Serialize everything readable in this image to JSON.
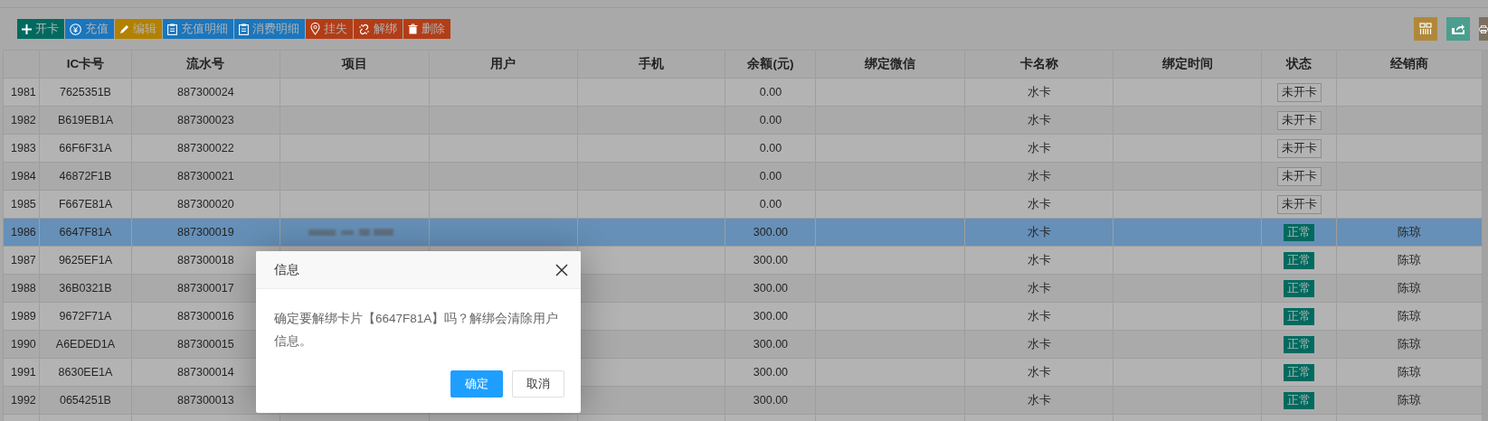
{
  "toolbar": {
    "buttons": [
      {
        "label": "开卡",
        "kind": "plus",
        "color": "#006a5f"
      },
      {
        "label": "充值",
        "kind": "yen",
        "color": "#1a76bd"
      },
      {
        "label": "编辑",
        "kind": "pencil",
        "color": "#b28100"
      },
      {
        "label": "充值明细",
        "kind": "clipboard",
        "color": "#1a76bd"
      },
      {
        "label": "消费明细",
        "kind": "clipboard",
        "color": "#1a76bd"
      },
      {
        "label": "挂失",
        "kind": "pin",
        "color": "#b23d17"
      },
      {
        "label": "解绑",
        "kind": "unlink",
        "color": "#b23d17"
      },
      {
        "label": "删除",
        "kind": "trash",
        "color": "#b23d17"
      }
    ],
    "tools": [
      {
        "kind": "grid",
        "color": "#b0883a"
      },
      {
        "kind": "export",
        "color": "#4a9f8f"
      },
      {
        "kind": "print",
        "color": "#7d7060"
      }
    ]
  },
  "table": {
    "columns": [
      "IC卡号",
      "流水号",
      "项目",
      "用户",
      "手机",
      "余额(元)",
      "绑定微信",
      "卡名称",
      "绑定时间",
      "状态",
      "经销商"
    ],
    "rows": [
      {
        "no": "1981",
        "ic_card": "7625351B",
        "serial": "887300024",
        "project_blurred": false,
        "balance": "0.00",
        "card_name": "水卡",
        "status": {
          "label": "未开卡",
          "kind": "outline"
        },
        "selected": false
      },
      {
        "no": "1982",
        "ic_card": "B619EB1A",
        "serial": "887300023",
        "project_blurred": false,
        "balance": "0.00",
        "card_name": "水卡",
        "status": {
          "label": "未开卡",
          "kind": "outline"
        },
        "selected": false
      },
      {
        "no": "1983",
        "ic_card": "66F6F31A",
        "serial": "887300022",
        "project_blurred": false,
        "balance": "0.00",
        "card_name": "水卡",
        "status": {
          "label": "未开卡",
          "kind": "outline"
        },
        "selected": false
      },
      {
        "no": "1984",
        "ic_card": "46872F1B",
        "serial": "887300021",
        "project_blurred": false,
        "balance": "0.00",
        "card_name": "水卡",
        "status": {
          "label": "未开卡",
          "kind": "outline"
        },
        "selected": false
      },
      {
        "no": "1985",
        "ic_card": "F667E81A",
        "serial": "887300020",
        "project_blurred": false,
        "balance": "0.00",
        "card_name": "水卡",
        "status": {
          "label": "未开卡",
          "kind": "outline"
        },
        "selected": false
      },
      {
        "no": "1986",
        "ic_card": "6647F81A",
        "serial": "887300019",
        "project_blurred": true,
        "balance": "300.00",
        "card_name": "水卡",
        "status": {
          "label": "正常",
          "kind": "filled"
        },
        "dealer": "陈琼",
        "selected": true
      },
      {
        "no": "1987",
        "ic_card": "9625EF1A",
        "serial": "887300018",
        "project_blurred": false,
        "balance": "300.00",
        "card_name": "水卡",
        "status": {
          "label": "正常",
          "kind": "filled"
        },
        "dealer": "陈琼",
        "selected": false
      },
      {
        "no": "1988",
        "ic_card": "36B0321B",
        "serial": "887300017",
        "project_blurred": false,
        "balance": "300.00",
        "card_name": "水卡",
        "status": {
          "label": "正常",
          "kind": "filled"
        },
        "dealer": "陈琼",
        "selected": false
      },
      {
        "no": "1989",
        "ic_card": "9672F71A",
        "serial": "887300016",
        "project_blurred": false,
        "balance": "300.00",
        "card_name": "水卡",
        "status": {
          "label": "正常",
          "kind": "filled"
        },
        "dealer": "陈琼",
        "selected": false
      },
      {
        "no": "1990",
        "ic_card": "A6EDED1A",
        "serial": "887300015",
        "project_blurred": false,
        "balance": "300.00",
        "card_name": "水卡",
        "status": {
          "label": "正常",
          "kind": "filled"
        },
        "dealer": "陈琼",
        "selected": false
      },
      {
        "no": "1991",
        "ic_card": "8630EE1A",
        "serial": "887300014",
        "project_blurred": false,
        "balance": "300.00",
        "card_name": "水卡",
        "status": {
          "label": "正常",
          "kind": "filled"
        },
        "dealer": "陈琼",
        "selected": false
      },
      {
        "no": "1992",
        "ic_card": "0654251B",
        "serial": "887300013",
        "project_blurred": false,
        "balance": "300.00",
        "card_name": "水卡",
        "status": {
          "label": "正常",
          "kind": "filled"
        },
        "dealer": "陈琼",
        "selected": false
      }
    ]
  },
  "dialog": {
    "title": "信息",
    "message": "确定要解绑卡片【6647F81A】吗？解绑会清除用户信息。",
    "buttons": [
      {
        "label": "确定",
        "kind": "primary"
      },
      {
        "label": "取消",
        "kind": "secondary"
      }
    ]
  }
}
